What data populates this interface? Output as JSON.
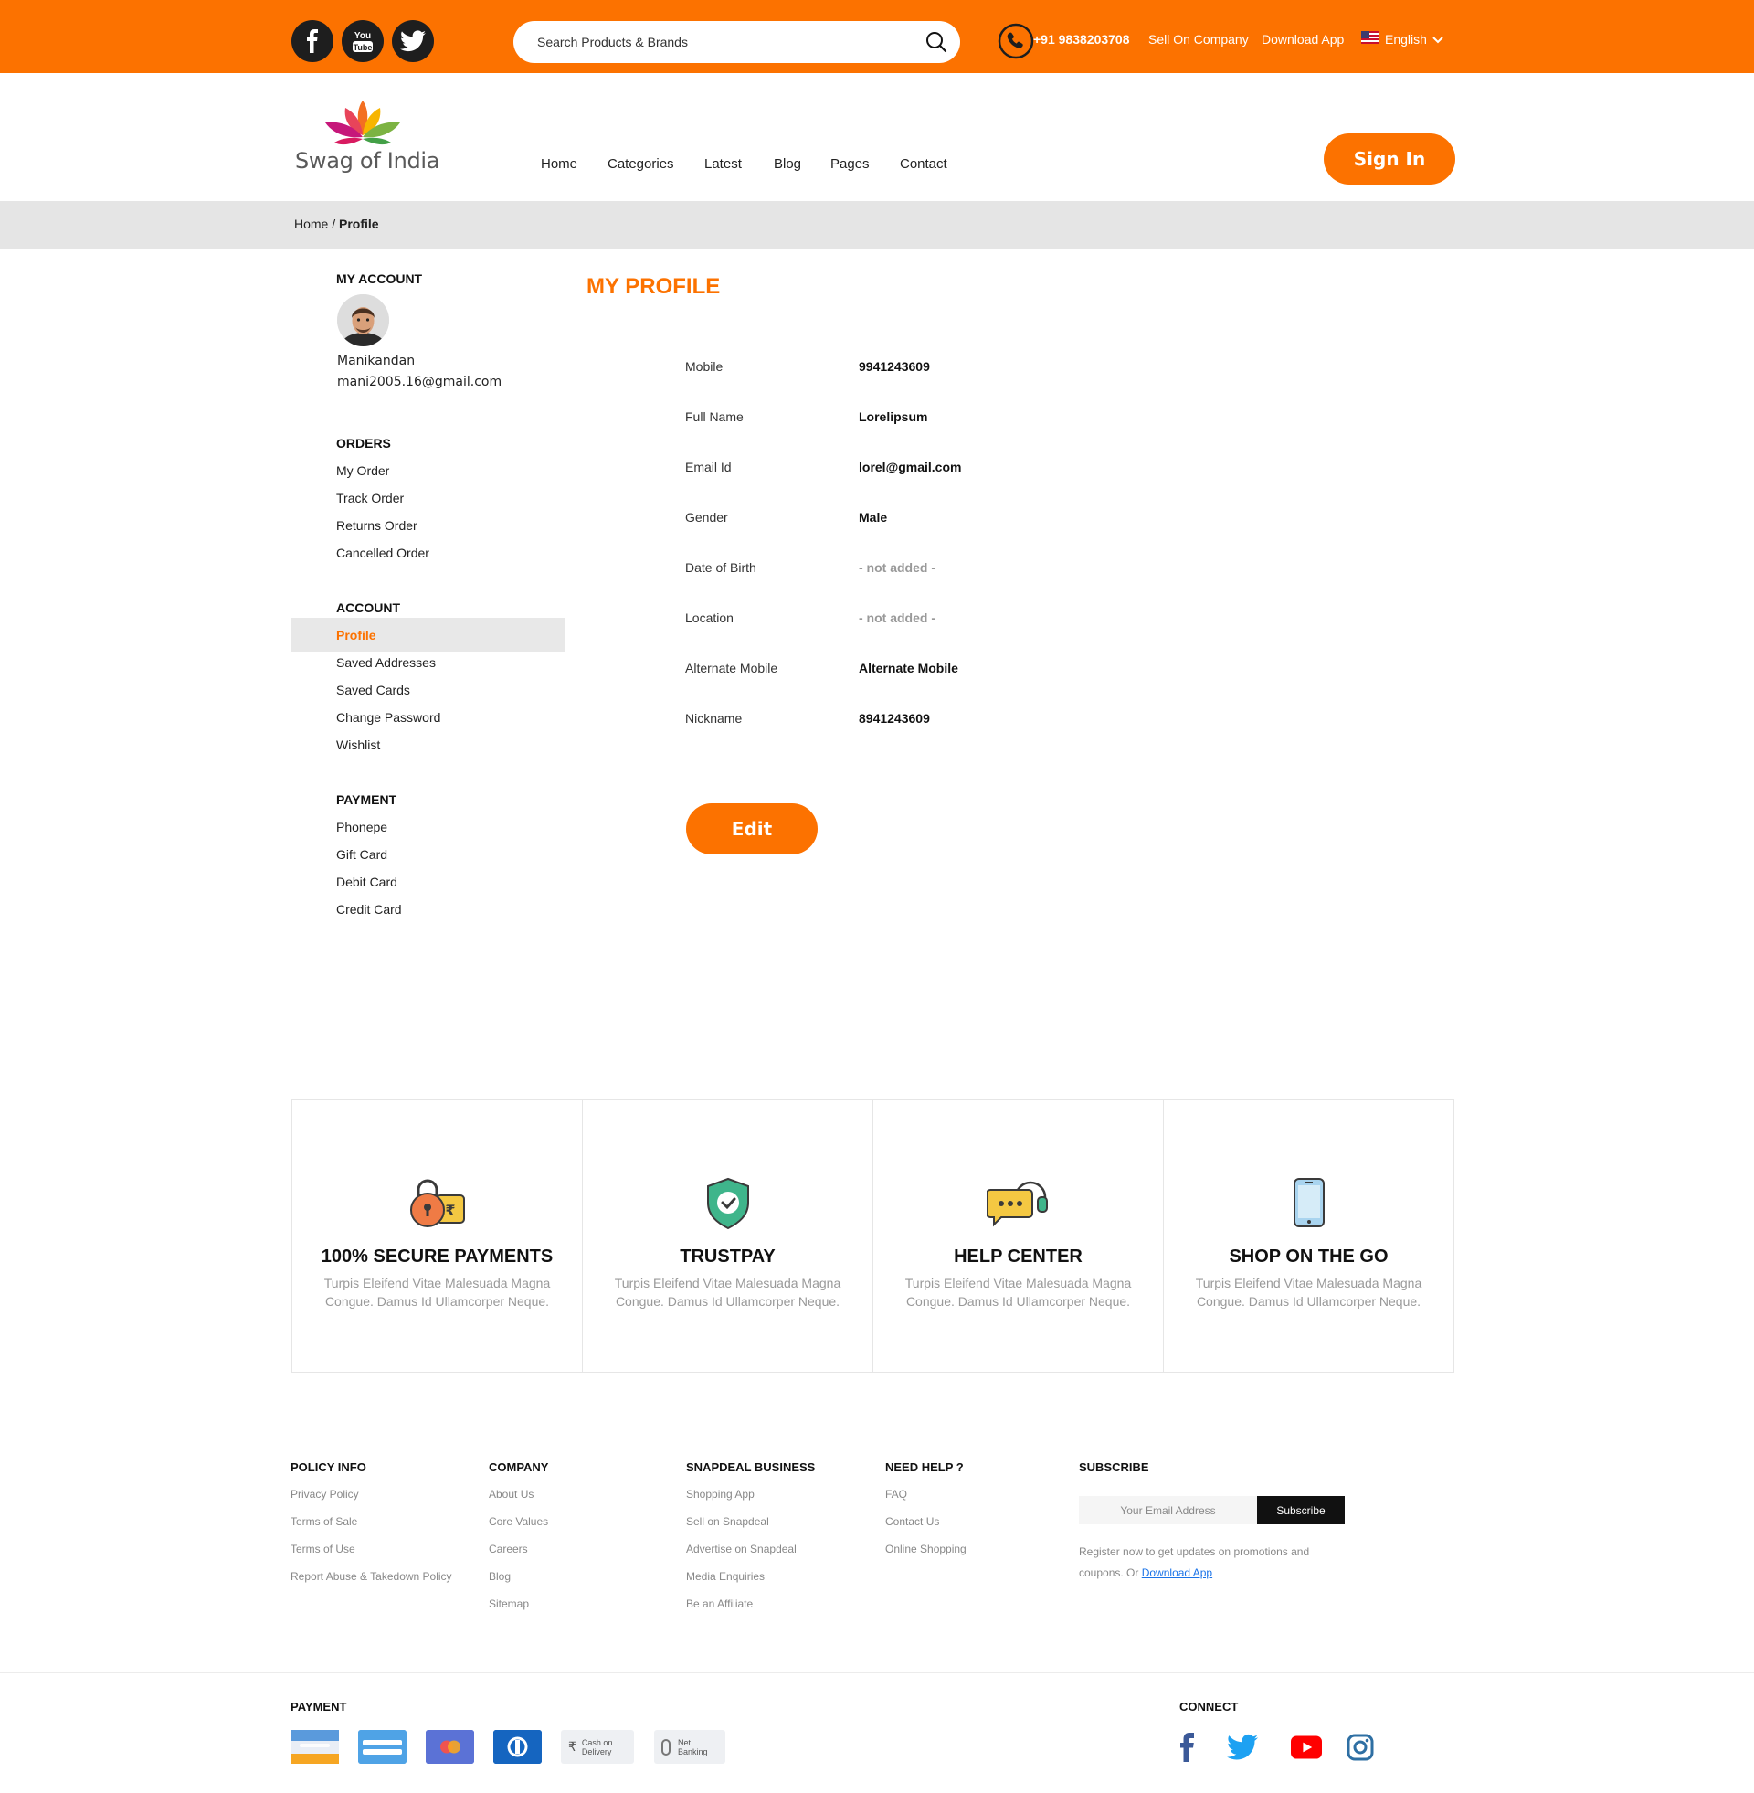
{
  "topbar": {
    "search_placeholder": "Search Products & Brands",
    "phone": "+91 9838203708",
    "sell_link": "Sell On Company",
    "download_link": "Download App",
    "language": "English",
    "social_icons": [
      "facebook-icon",
      "youtube-icon",
      "twitter-icon"
    ]
  },
  "header": {
    "brand": "Swag of India",
    "nav": [
      "Home",
      "Categories",
      "Latest",
      "Blog",
      "Pages",
      "Contact"
    ],
    "signin_label": "Sign In"
  },
  "breadcrumb": {
    "home": "Home /",
    "current": "Profile"
  },
  "sidebar": {
    "account_heading": "MY ACCOUNT",
    "user_name": "Manikandan",
    "user_email": "mani2005.16@gmail.com",
    "orders_heading": "ORDERS",
    "orders": [
      "My Order",
      "Track Order",
      "Returns Order",
      "Cancelled Order"
    ],
    "account_section_heading": "ACCOUNT",
    "account_items": [
      "Profile",
      "Saved Addresses",
      "Saved Cards",
      "Change Password",
      "Wishlist"
    ],
    "active_item": "Profile",
    "payment_heading": "PAYMENT",
    "payment_items": [
      "Phonepe",
      "Gift Card",
      "Debit Card",
      "Credit Card"
    ]
  },
  "profile": {
    "title": "MY PROFILE",
    "fields": [
      {
        "label": "Mobile",
        "value": "9941243609"
      },
      {
        "label": "Full Name",
        "value": "Lorelipsum"
      },
      {
        "label": "Email Id",
        "value": "lorel@gmail.com"
      },
      {
        "label": "Gender",
        "value": "Male"
      },
      {
        "label": "Date of Birth",
        "value": "- not added -"
      },
      {
        "label": "Location",
        "value": "- not added -"
      },
      {
        "label": "Alternate Mobile",
        "value": "Alternate Mobile"
      },
      {
        "label": "Nickname",
        "value": "8941243609"
      }
    ],
    "edit_label": "Edit"
  },
  "features": [
    {
      "title": "100% SECURE PAYMENTS",
      "desc": "Turpis Eleifend Vitae Malesuada Magna Congue. Damus Id Ullamcorper Neque.",
      "icon": "secure-payment-icon"
    },
    {
      "title": "TRUSTPAY",
      "desc": "Turpis Eleifend Vitae Malesuada Magna Congue. Damus Id Ullamcorper Neque.",
      "icon": "shield-check-icon"
    },
    {
      "title": "HELP CENTER",
      "desc": "Turpis Eleifend Vitae Malesuada Magna Congue. Damus Id Ullamcorper Neque.",
      "icon": "chat-headset-icon"
    },
    {
      "title": "SHOP ON THE GO",
      "desc": "Turpis Eleifend Vitae Malesuada Magna Congue. Damus Id Ullamcorper Neque.",
      "icon": "mobile-phone-icon"
    }
  ],
  "footer": {
    "policy": {
      "heading": "POLICY INFO",
      "links": [
        "Privacy Policy",
        "Terms of Sale",
        "Terms of Use",
        "Report Abuse & Takedown Policy"
      ]
    },
    "company": {
      "heading": "COMPANY",
      "links": [
        "About Us",
        "Core Values",
        "Careers",
        "Blog",
        "Sitemap"
      ]
    },
    "business": {
      "heading": "SNAPDEAL BUSINESS",
      "links": [
        "Shopping App",
        "Sell on Snapdeal",
        "Advertise on Snapdeal",
        "Media Enquiries",
        "Be an Affiliate"
      ]
    },
    "help": {
      "heading": "NEED HELP ?",
      "links": [
        "FAQ",
        "Contact Us",
        "Online Shopping"
      ]
    },
    "subscribe": {
      "heading": "SUBSCRIBE",
      "placeholder": "Your Email Address",
      "button": "Subscribe",
      "note": "Register now to get updates on promotions and coupons. Or",
      "note_link": "Download App"
    },
    "payment_heading": "PAYMENT",
    "payment_cards": [
      {
        "name": "card-icon",
        "text": ""
      },
      {
        "name": "card-icon",
        "text": ""
      },
      {
        "name": "mastercard-icon",
        "text": ""
      },
      {
        "name": "diners-icon",
        "text": ""
      },
      {
        "name": "cash-on-delivery-icon",
        "text": "Cash on Delivery"
      },
      {
        "name": "net-banking-icon",
        "text": "Net Banking"
      }
    ],
    "connect_heading": "CONNECT",
    "connect_icons": [
      "facebook-icon",
      "twitter-icon",
      "youtube-icon",
      "instagram-icon"
    ]
  },
  "colors": {
    "accent": "#fc7200",
    "dark": "#1e1e1e"
  }
}
